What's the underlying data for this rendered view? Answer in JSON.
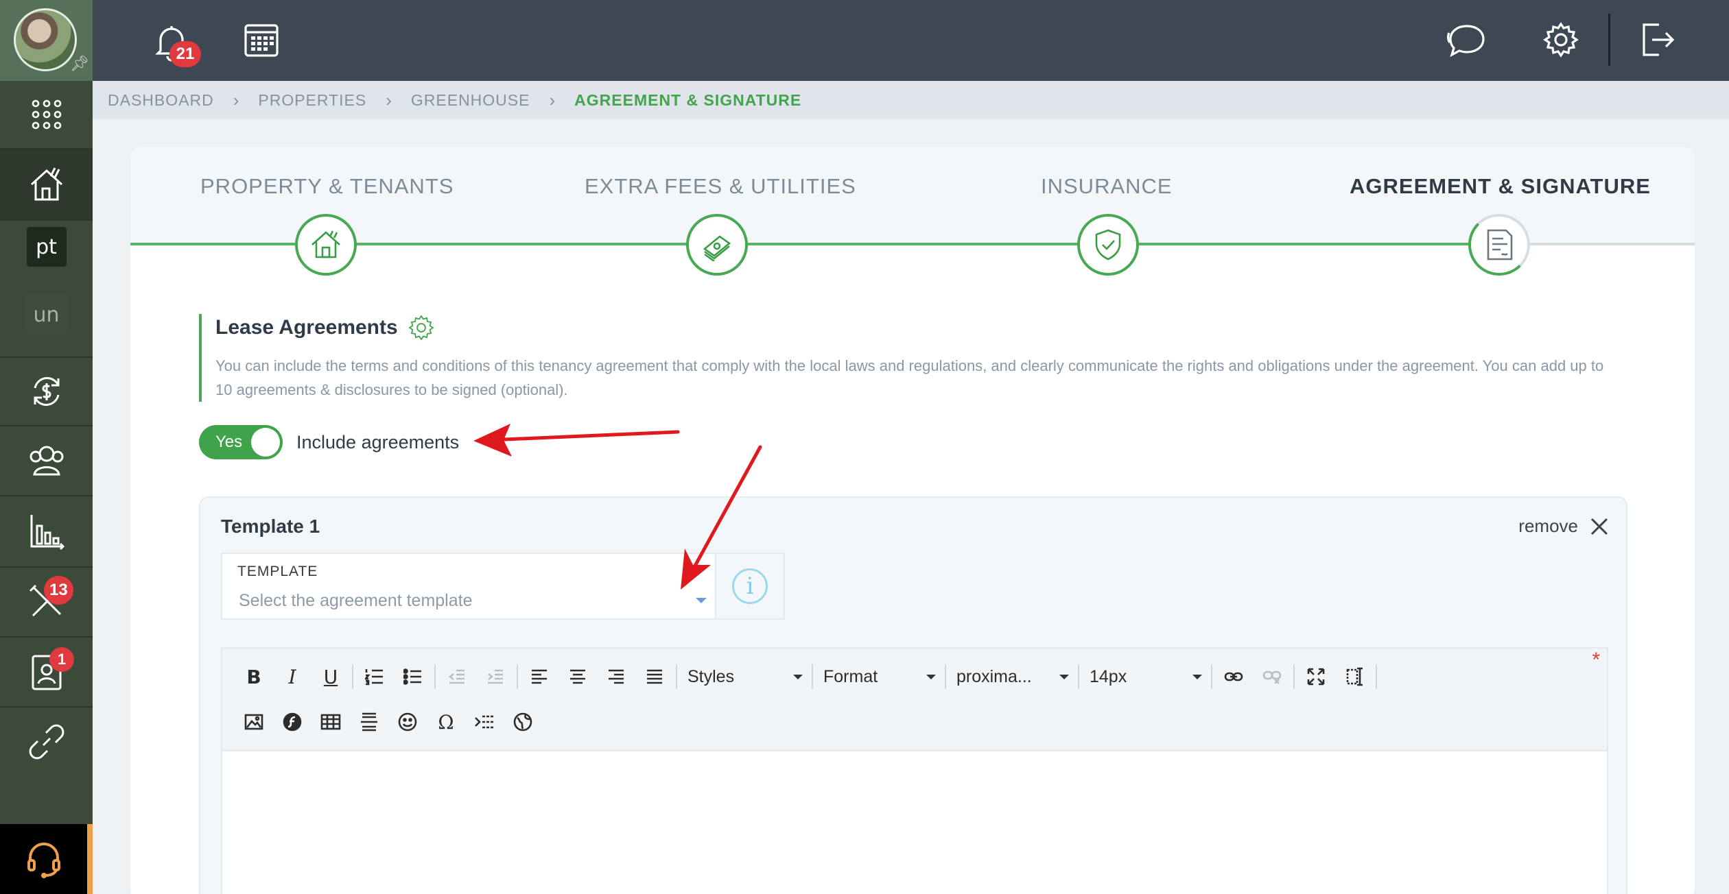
{
  "sidebar": {
    "items": [
      {
        "name": "apps",
        "icon": "grid-icon"
      },
      {
        "name": "properties",
        "icon": "house-icon"
      },
      {
        "name": "pt",
        "label": "pt"
      },
      {
        "name": "un",
        "label": "un"
      },
      {
        "name": "payments",
        "icon": "currency-exchange-icon"
      },
      {
        "name": "people",
        "icon": "people-icon"
      },
      {
        "name": "reports",
        "icon": "bar-chart-icon"
      },
      {
        "name": "maintenance",
        "icon": "tools-icon",
        "badge": "13"
      },
      {
        "name": "applications",
        "icon": "contact-card-icon",
        "badge": "1"
      },
      {
        "name": "links",
        "icon": "link-icon"
      }
    ],
    "support_icon": "headset-icon"
  },
  "topbar": {
    "notifications_badge": "21"
  },
  "breadcrumb": [
    "DASHBOARD",
    "PROPERTIES",
    "GREENHOUSE",
    "AGREEMENT & SIGNATURE"
  ],
  "steps": [
    {
      "label": "PROPERTY & TENANTS",
      "icon": "house-icon"
    },
    {
      "label": "EXTRA FEES & UTILITIES",
      "icon": "money-stack-icon"
    },
    {
      "label": "INSURANCE",
      "icon": "shield-icon"
    },
    {
      "label": "AGREEMENT & SIGNATURE",
      "icon": "document-icon"
    }
  ],
  "lease": {
    "title": "Lease Agreements",
    "description": "You can include the terms and conditions of this tenancy agreement that comply with the local laws and regulations, and clearly communicate the rights and obligations under the agreement. You can add up to 10 agreements & disclosures to be signed (optional).",
    "toggle_value": "Yes",
    "toggle_label": "Include agreements"
  },
  "template": {
    "title": "Template 1",
    "remove_label": "remove",
    "select_label": "TEMPLATE",
    "select_placeholder": "Select the agreement template",
    "info_glyph": "i"
  },
  "editor": {
    "styles_label": "Styles",
    "format_label": "Format",
    "font_label": "proxima...",
    "size_label": "14px",
    "required_mark": "*"
  },
  "colors": {
    "accent_green": "#44a34d",
    "badge_red": "#e0393e",
    "annotation_red": "#e0191f",
    "topbar": "#3d4854",
    "sidebar": "#3c4a3a"
  }
}
